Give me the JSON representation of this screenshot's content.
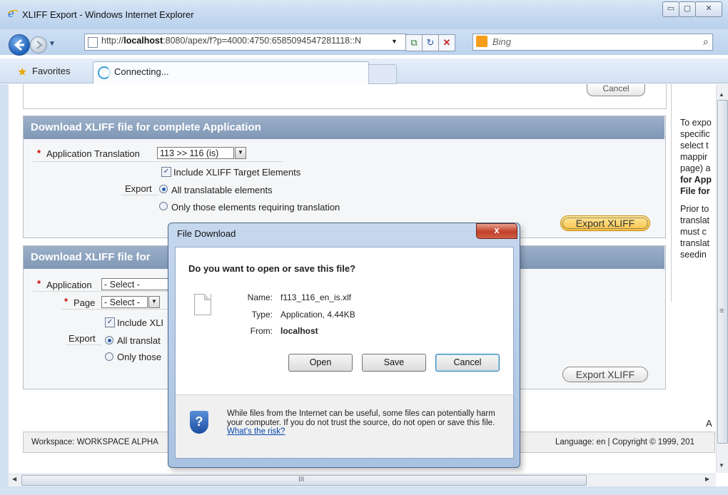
{
  "window": {
    "title": "XLIFF Export - Windows Internet Explorer",
    "address_plain_prefix": "http://",
    "address_bold": "localhost",
    "address_rest": ":8080/apex/f?p=4000:4750:6585094547281118::N",
    "search_placeholder": "Bing",
    "favorites_label": "Favorites",
    "tab_label": "Connecting...",
    "minimize_glyph": "▭",
    "maximize_glyph": "▢",
    "close_glyph": "✕"
  },
  "top_panel": {
    "cancel_label": "Cancel"
  },
  "panel1": {
    "title": "Download XLIFF file for complete Application",
    "app_translation_label": "Application Translation",
    "app_translation_value": "113 >> 116 (is)",
    "include_target_label": "Include XLIFF Target Elements",
    "include_target_checked": true,
    "export_label": "Export",
    "radio_all": "All translatable elements",
    "radio_only": "Only those elements requiring translation",
    "selected_radio": "all",
    "export_button": "Export XLIFF"
  },
  "panel2": {
    "title": "Download XLIFF file for",
    "application_label": "Application",
    "application_value": "- Select -",
    "page_label": "Page",
    "page_value": "- Select -",
    "include_target_label": "Include XLI",
    "export_label": "Export",
    "radio_all": "All translat",
    "radio_only": "Only those",
    "export_button": "Export XLIFF"
  },
  "sidebar": {
    "lines": [
      "To expo",
      "specific",
      "select t",
      "mappir",
      "page) a"
    ],
    "bold_lines": [
      "for App",
      "File for"
    ],
    "lines2": [
      "Prior to",
      "translat",
      "must c",
      "translat",
      "seedin"
    ]
  },
  "footer": {
    "workspace": "Workspace: WORKSPACE ALPHA",
    "right": "Language: en | Copyright © 1999, 201",
    "a_letter": "A"
  },
  "dialog": {
    "title": "File Download",
    "close_glyph": "x",
    "question": "Do you want to open or save this file?",
    "name_key": "Name:",
    "name_val": "f113_116_en_is.xlf",
    "type_key": "Type:",
    "type_val": "Application, 4.44KB",
    "from_key": "From:",
    "from_val": "localhost",
    "open": "Open",
    "save": "Save",
    "cancel": "Cancel",
    "warning": "While files from the Internet can be useful, some files can potentially harm your computer. If you do not trust the source, do not open or save this file.",
    "risk_link": "What's the risk?"
  },
  "scroll": {
    "h_grip": "III",
    "v_grip": "≡"
  }
}
